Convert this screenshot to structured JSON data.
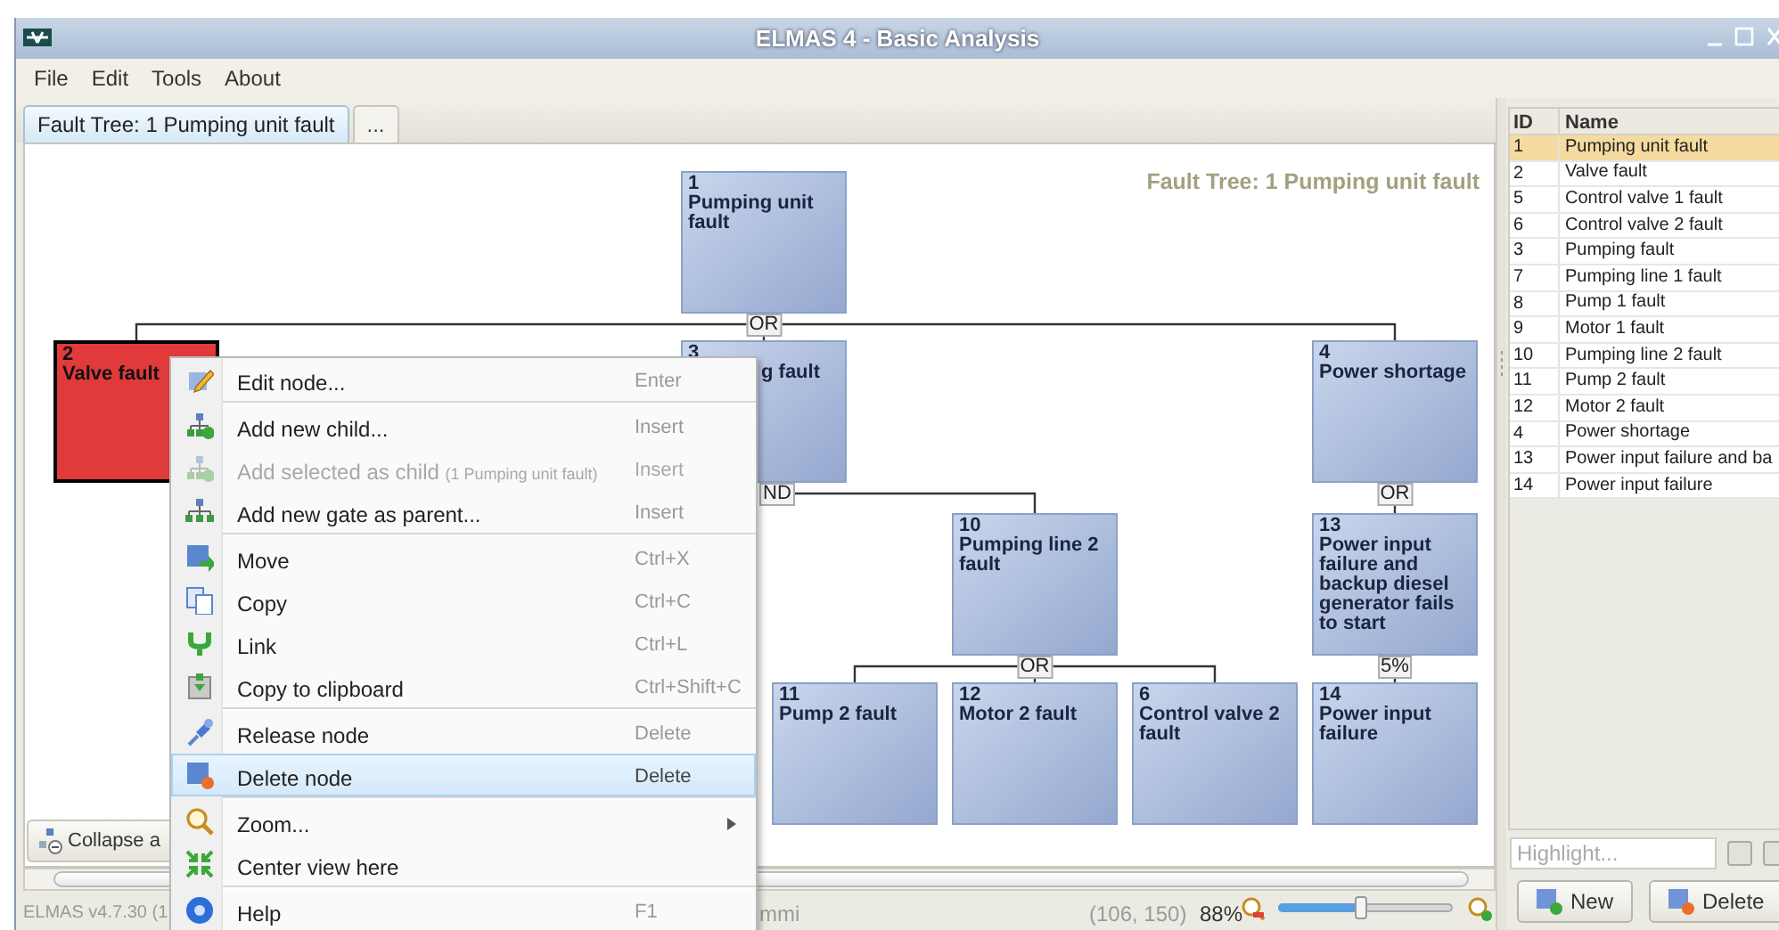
{
  "window": {
    "title": "ELMAS 4 - Basic Analysis"
  },
  "menu_bar": [
    "File",
    "Edit",
    "Tools",
    "About"
  ],
  "tabs": [
    {
      "label": "Fault Tree: 1 Pumping unit fault",
      "selected": true
    },
    {
      "label": "...",
      "selected": false
    }
  ],
  "canvas": {
    "title": "Fault Tree: 1 Pumping unit fault",
    "tree": {
      "number": "1",
      "label": "Pumping unit fault",
      "selected": false,
      "partly_hidden": false,
      "gate": "OR",
      "children": [
        {
          "number": "2",
          "label": "Valve fault",
          "selected": true,
          "partly_hidden": false
        },
        {
          "number": "3",
          "label": "g fault",
          "selected": false,
          "partly_hidden": true,
          "gate": "ND",
          "children": [
            {
              "number": "10",
              "label": "Pumping line 2 fault",
              "selected": false,
              "partly_hidden": false,
              "gate": "OR",
              "children": [
                {
                  "number": "11",
                  "label": "Pump 2 fault",
                  "selected": false,
                  "partly_hidden": false
                },
                {
                  "number": "12",
                  "label": "Motor 2 fault",
                  "selected": false,
                  "partly_hidden": false
                },
                {
                  "number": "6",
                  "label": "Control valve 2 fault",
                  "selected": false,
                  "partly_hidden": false
                }
              ]
            }
          ]
        },
        {
          "number": "4",
          "label": "Power shortage",
          "selected": false,
          "partly_hidden": false,
          "gate": "OR",
          "children": [
            {
              "number": "13",
              "label": "Power input failure and backup diesel generator fails to start",
              "selected": false,
              "partly_hidden": false,
              "gate": "5%",
              "children": [
                {
                  "number": "14",
                  "label": "Power input failure",
                  "selected": false,
                  "partly_hidden": false
                }
              ]
            }
          ]
        }
      ]
    },
    "collapse_button": "Collapse a"
  },
  "context_menu": {
    "groups": [
      [
        {
          "label": "Edit node...",
          "shortcut": "Enter",
          "disabled": false,
          "selected": false,
          "submenu": false
        }
      ],
      [
        {
          "label": "Add new child...",
          "shortcut": "Insert",
          "disabled": false,
          "selected": false,
          "submenu": false
        },
        {
          "label": "Add selected as child",
          "hint": "(1 Pumping unit fault)",
          "shortcut": "Insert",
          "disabled": true,
          "selected": false,
          "submenu": false
        },
        {
          "label": "Add new gate as parent...",
          "shortcut": "Insert",
          "disabled": false,
          "selected": false,
          "submenu": false
        }
      ],
      [
        {
          "label": "Move",
          "shortcut": "Ctrl+X",
          "disabled": false,
          "selected": false,
          "submenu": false
        },
        {
          "label": "Copy",
          "shortcut": "Ctrl+C",
          "disabled": false,
          "selected": false,
          "submenu": false
        },
        {
          "label": "Link",
          "shortcut": "Ctrl+L",
          "disabled": false,
          "selected": false,
          "submenu": false
        },
        {
          "label": "Copy to clipboard",
          "shortcut": "Ctrl+Shift+C",
          "disabled": false,
          "selected": false,
          "submenu": false
        }
      ],
      [
        {
          "label": "Release node",
          "shortcut": "Delete",
          "disabled": false,
          "selected": false,
          "submenu": false
        },
        {
          "label": "Delete node",
          "shortcut": "Delete",
          "disabled": false,
          "selected": true,
          "submenu": false
        }
      ],
      [
        {
          "label": "Zoom...",
          "disabled": false,
          "selected": false,
          "submenu": true
        },
        {
          "label": "Center view here",
          "disabled": false,
          "selected": false,
          "submenu": false
        }
      ],
      [
        {
          "label": "Help",
          "shortcut": "F1",
          "disabled": false,
          "selected": false,
          "submenu": false
        }
      ]
    ]
  },
  "elements_table": {
    "columns": [
      "ID",
      "Name"
    ],
    "rows": [
      {
        "id": "1",
        "name": "Pumping unit fault",
        "selected": true
      },
      {
        "id": "2",
        "name": "Valve fault",
        "selected": false
      },
      {
        "id": "5",
        "name": "Control valve 1 fault",
        "selected": false
      },
      {
        "id": "6",
        "name": "Control valve 2 fault",
        "selected": false
      },
      {
        "id": "3",
        "name": "Pumping fault",
        "selected": false
      },
      {
        "id": "7",
        "name": "Pumping line 1 fault",
        "selected": false
      },
      {
        "id": "8",
        "name": "Pump 1 fault",
        "selected": false
      },
      {
        "id": "9",
        "name": "Motor 1 fault",
        "selected": false
      },
      {
        "id": "10",
        "name": "Pumping line 2 fault",
        "selected": false
      },
      {
        "id": "11",
        "name": "Pump 2 fault",
        "selected": false
      },
      {
        "id": "12",
        "name": "Motor 2 fault",
        "selected": false
      },
      {
        "id": "4",
        "name": "Power shortage",
        "selected": false
      },
      {
        "id": "13",
        "name": "Power input failure and ba",
        "selected": false
      },
      {
        "id": "14",
        "name": "Power input failure",
        "selected": false
      }
    ]
  },
  "highlight": {
    "placeholder": "Highlight..."
  },
  "buttons": [
    "New",
    "Delete"
  ],
  "status_bar": {
    "version": "ELMAS v4.7.30 (1",
    "user": "mmi",
    "coordinates": "(106, 150)",
    "zoom": "88%",
    "zoom_slider": {
      "level": 0.47
    }
  }
}
